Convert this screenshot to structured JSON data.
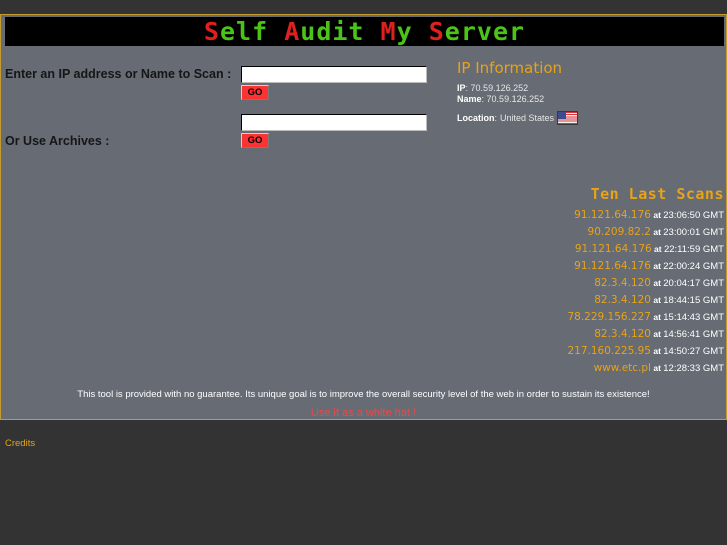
{
  "site": {
    "title_segments": [
      {
        "text": "S",
        "color": "#E02020"
      },
      {
        "text": "elf",
        "color": "#4CC417"
      },
      {
        "text": " ",
        "color": "#000000"
      },
      {
        "text": "A",
        "color": "#E02020"
      },
      {
        "text": "udit",
        "color": "#4CC417"
      },
      {
        "text": " ",
        "color": "#000000"
      },
      {
        "text": "M",
        "color": "#E02020"
      },
      {
        "text": "y",
        "color": "#4CC417"
      },
      {
        "text": " ",
        "color": "#000000"
      },
      {
        "text": "S",
        "color": "#E02020"
      },
      {
        "text": "erver",
        "color": "#4CC417"
      }
    ],
    "title_plain": "Self Audit My Server"
  },
  "form": {
    "scan": {
      "label": "Enter an IP address or Name to Scan :",
      "input_value": "",
      "input_placeholder": "",
      "submit_label": "GO"
    },
    "archives": {
      "label": "Or Use Archives :",
      "input_value": "",
      "input_placeholder": "",
      "submit_label": "GO"
    }
  },
  "ip_information": {
    "heading": "IP Information",
    "ip_key": "IP",
    "ip_value": "70.59.126.252",
    "name_key": "Name",
    "name_value": "70.59.126.252",
    "location_key": "Location",
    "location_value": "United States",
    "location_flag": "us-flag-icon",
    "separator": ":"
  },
  "ten_last_scans": {
    "heading": "Ten Last Scans",
    "at_label": "at",
    "tz_label": "GMT",
    "rows": [
      {
        "target": "91.121.64.176",
        "time": "23:06:50"
      },
      {
        "target": "90.209.82.2",
        "time": "23:00:01"
      },
      {
        "target": "91.121.64.176",
        "time": "22:11:59"
      },
      {
        "target": "91.121.64.176",
        "time": "22:00:24"
      },
      {
        "target": "82.3.4.120",
        "time": "20:04:17"
      },
      {
        "target": "82.3.4.120",
        "time": "18:44:15"
      },
      {
        "target": "78.229.156.227",
        "time": "15:14:43"
      },
      {
        "target": "82.3.4.120",
        "time": "14:56:41"
      },
      {
        "target": "217.160.225.95",
        "time": "14:50:27"
      },
      {
        "target": "www.etc.pl",
        "time": "12:28:33"
      }
    ]
  },
  "footer": {
    "note": "This tool is provided with no guarantee. Its unique goal is to improve the overall security level of the web in order to sustain its existence!",
    "warning": "Use it as a white hat !",
    "credits_label": "Credits"
  },
  "colors": {
    "page_background": "#333333",
    "content_background": "#666B74",
    "border_gold": "#C59B2E",
    "banner_background": "#000000",
    "accent_orange": "#E8A317",
    "accent_red": "#E02020",
    "accent_green": "#4CC417",
    "button_red": "#FC3333",
    "warning_red": "#E84A4A"
  }
}
